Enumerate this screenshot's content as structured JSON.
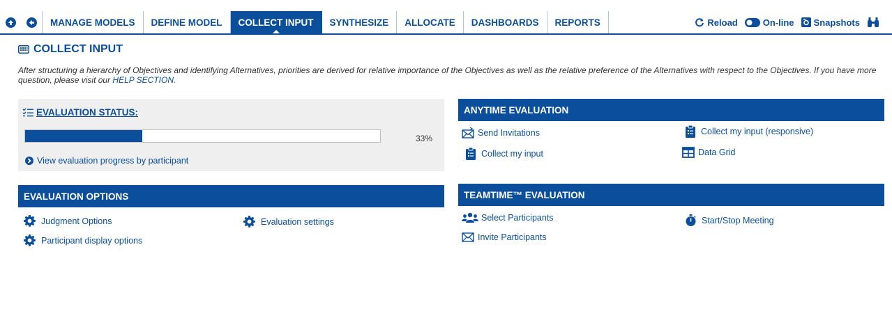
{
  "nav": {
    "back_icon": "circle-up-arrow-icon",
    "prev_icon": "circle-left-arrow-icon",
    "tabs": [
      {
        "label": "MANAGE MODELS"
      },
      {
        "label": "DEFINE MODEL"
      },
      {
        "label": "COLLECT INPUT",
        "active": true
      },
      {
        "label": "SYNTHESIZE"
      },
      {
        "label": "ALLOCATE"
      },
      {
        "label": "DASHBOARDS"
      },
      {
        "label": "REPORTS"
      }
    ],
    "reload": "Reload",
    "online": "On-line",
    "snapshots": "Snapshots"
  },
  "page": {
    "title": "COLLECT INPUT",
    "intro": "After structuring a hierarchy of Objectives and identifying Alternatives, priorities are derived for relative importance of the Objectives as well as the relative preference of the Alternatives with respect to the Objectives. If you have more question, please visit our ",
    "help_link": "HELP SECTION",
    "intro_end": "."
  },
  "status": {
    "title": "EVALUATION STATUS:",
    "progress": 0.33,
    "percent_label": "33%",
    "view_link": "View evaluation progress by participant"
  },
  "options": {
    "title": "EVALUATION OPTIONS",
    "judgment": "Judgment Options",
    "participant_display": "Participant display options",
    "settings": "Evaluation settings"
  },
  "anytime": {
    "title": "ANYTIME EVALUATION",
    "send": "Send Invitations",
    "collect": "Collect my input",
    "collect_responsive": "Collect my input (responsive)",
    "grid": "Data Grid"
  },
  "teamtime": {
    "title": "TEAMTIME™ EVALUATION",
    "select": "Select Participants",
    "invite": "Invite Participants",
    "meeting": "Start/Stop Meeting"
  },
  "colors": {
    "brand": "#0b4f9c",
    "panel": "#efefef"
  }
}
